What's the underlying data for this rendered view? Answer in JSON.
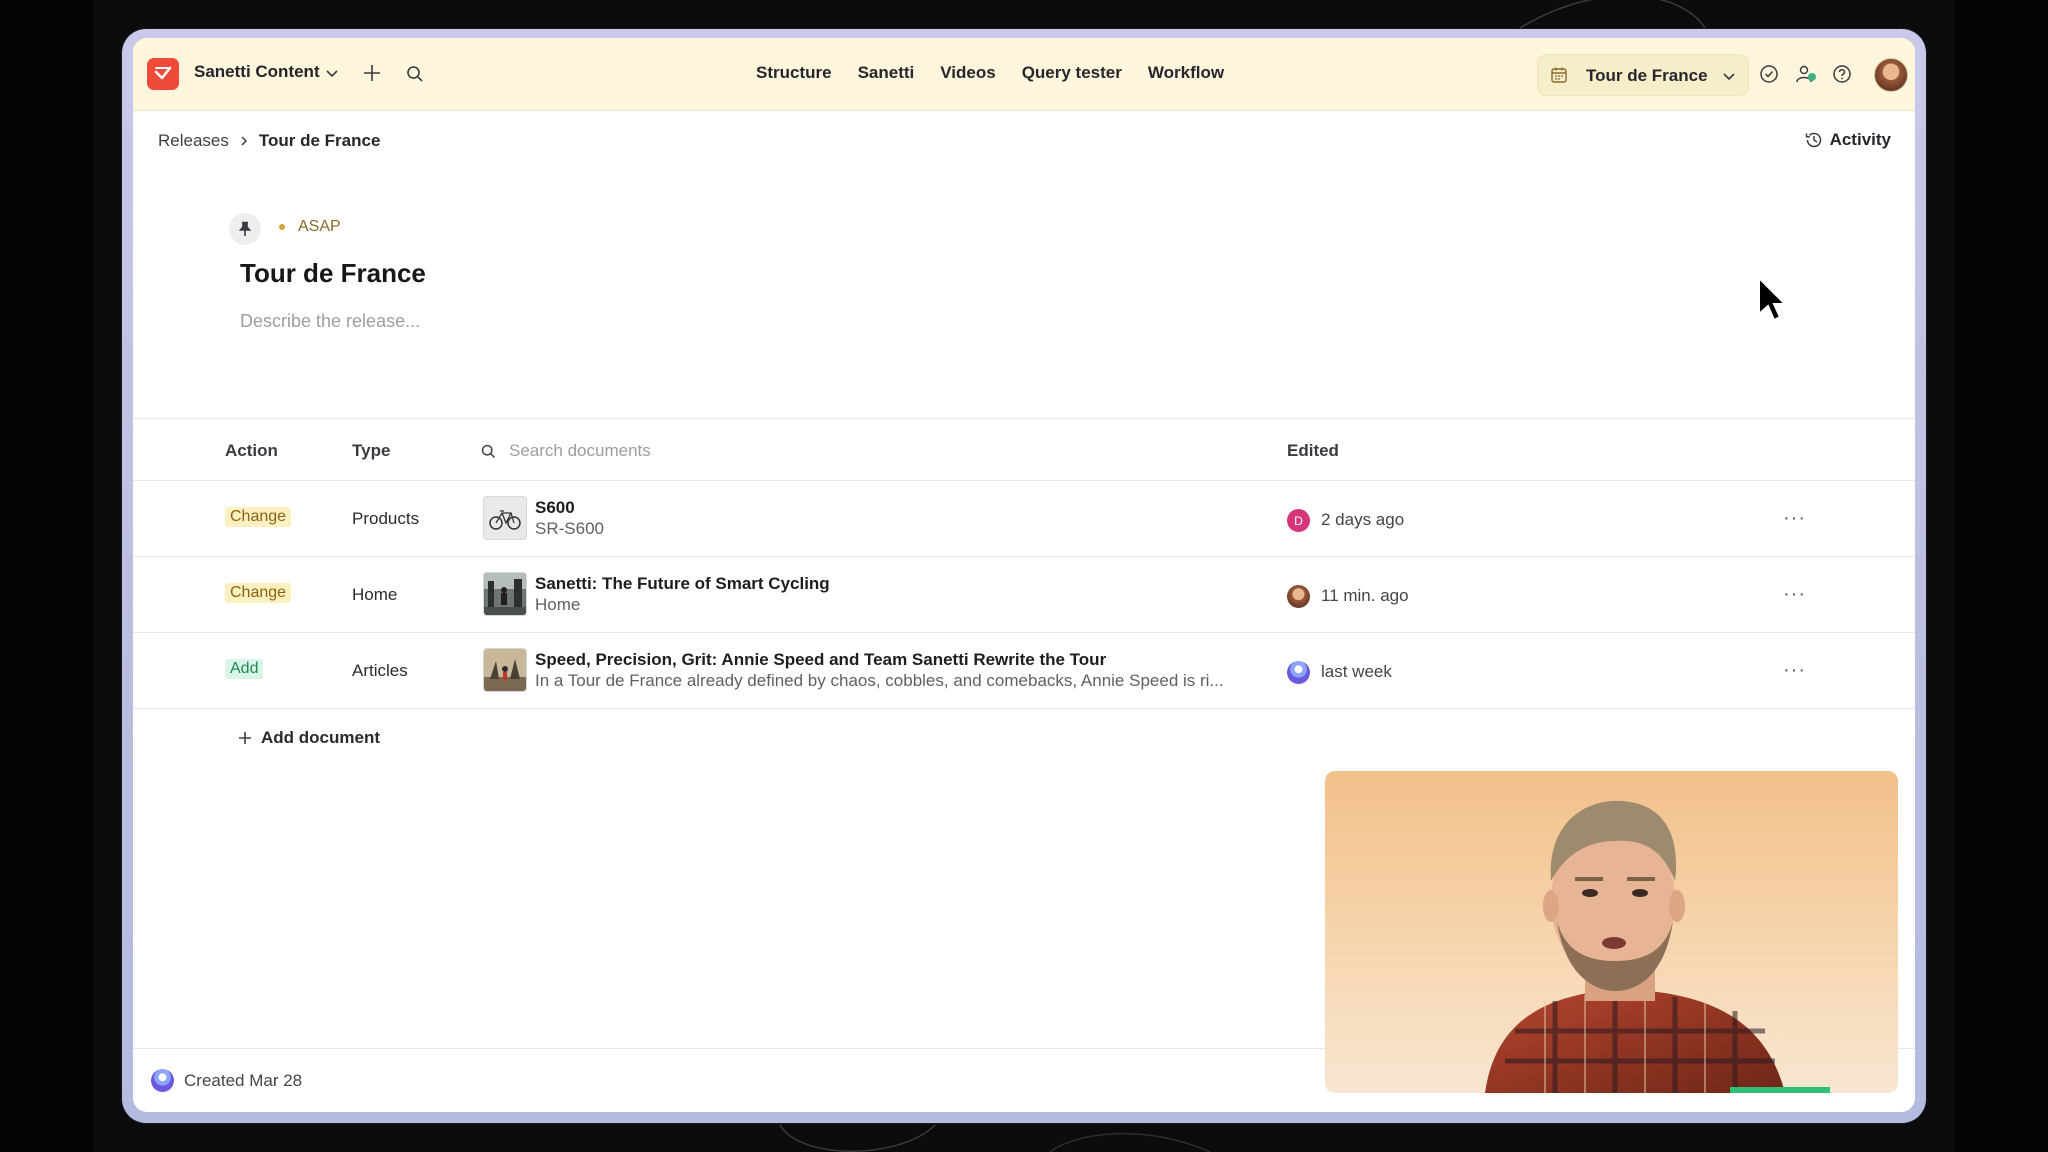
{
  "topnav": {
    "workspace": "Sanetti Content",
    "links": [
      "Structure",
      "Sanetti",
      "Videos",
      "Query tester",
      "Workflow"
    ],
    "release_selector": "Tour de France"
  },
  "breadcrumb": {
    "parent": "Releases",
    "current": "Tour de France",
    "activity": "Activity"
  },
  "release": {
    "timing": "ASAP",
    "title": "Tour de France",
    "description_placeholder": "Describe the release..."
  },
  "table": {
    "headers": {
      "action": "Action",
      "type": "Type",
      "search_placeholder": "Search documents",
      "edited": "Edited"
    },
    "rows": [
      {
        "action": "Change",
        "type": "Products",
        "title": "S600",
        "subtitle": "SR-S600",
        "edited_by_initial": "D",
        "edited": "2 days ago"
      },
      {
        "action": "Change",
        "type": "Home",
        "title": "Sanetti: The Future of Smart Cycling",
        "subtitle": "Home",
        "edited": "11 min. ago"
      },
      {
        "action": "Add",
        "type": "Articles",
        "title": "Speed, Precision, Grit: Annie Speed and Team Sanetti Rewrite the Tour",
        "subtitle": "In a Tour de France already defined by chaos, cobbles, and comebacks, Annie Speed is ri...",
        "edited": "last week"
      }
    ],
    "add_document": "Add document"
  },
  "footer": {
    "created": "Created Mar 28"
  },
  "colors": {
    "topbar_bg": "#fdf6dc",
    "logo": "#f04b3a",
    "change_badge_bg": "#fbf0bf",
    "add_badge_bg": "#d9f5e7"
  }
}
